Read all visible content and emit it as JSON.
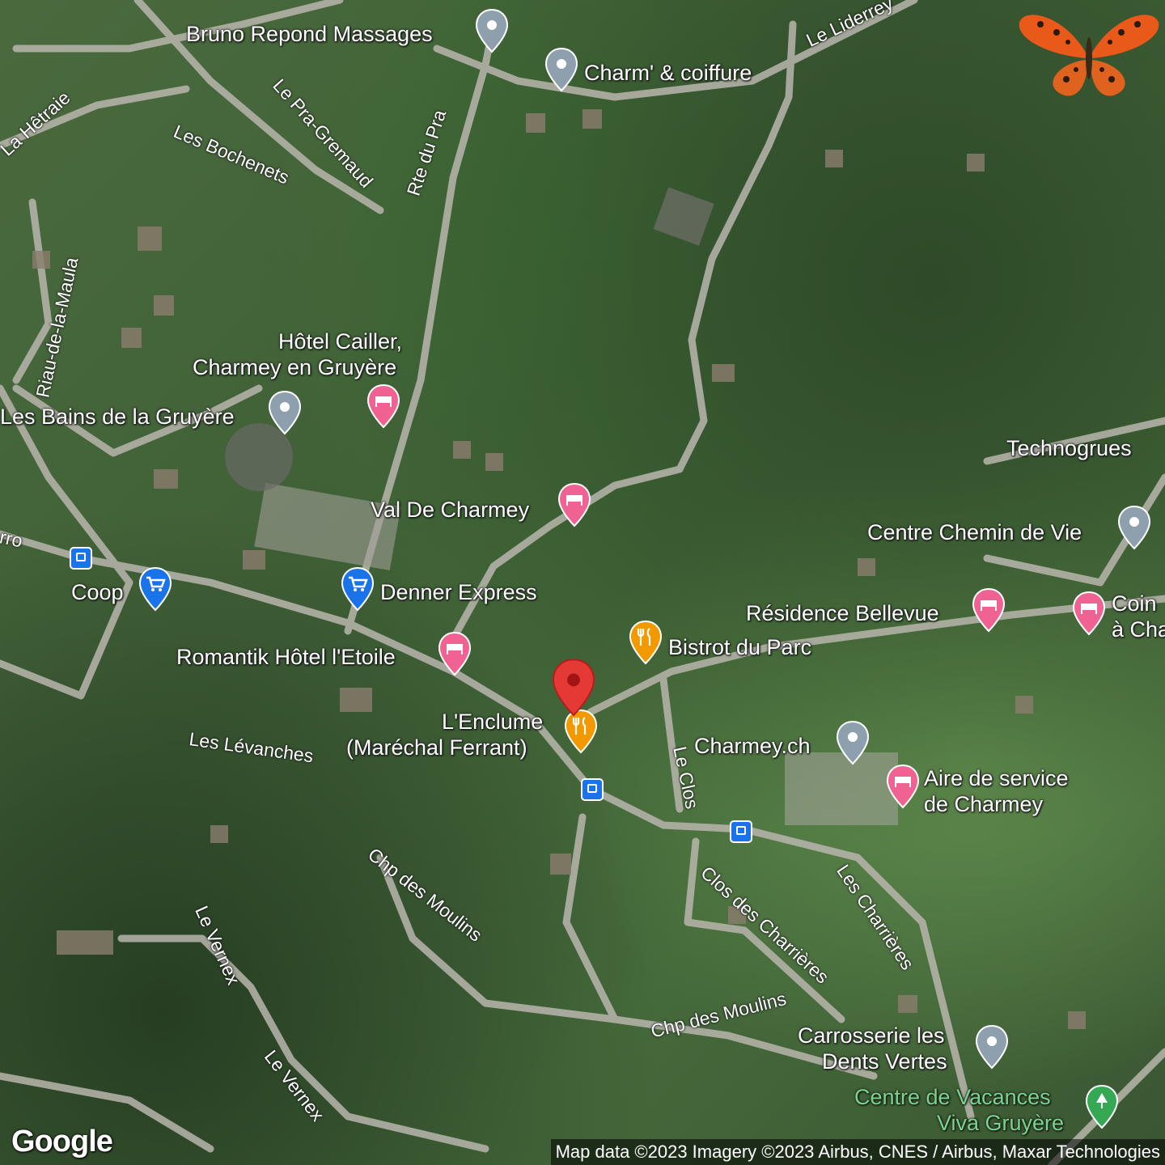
{
  "map": {
    "type": "satellite",
    "selected_marker": "L'Enclume (Maréchal Ferrant)",
    "colors": {
      "selected_pin": "#e53935",
      "lodging_pin": "#f06292",
      "restaurant_pin": "#f29900",
      "shopping_pin": "#1a73e8",
      "generic_pin": "#8ea0ad",
      "park_pin": "#34a853",
      "transit": "#1a73e8"
    }
  },
  "places": {
    "bruno": "Bruno Repond Massages",
    "charm": "Charm' & coiffure",
    "hotel_cailler_1": "Hôtel Cailler,",
    "hotel_cailler_2": "Charmey en Gruyère",
    "bains": "Les Bains de la Gruyère",
    "val_de_charmey": "Val De Charmey",
    "coop": "Coop",
    "denner": "Denner Express",
    "romantik": "Romantik Hôtel l'Etoile",
    "bistrot": "Bistrot du Parc",
    "residence": "Résidence Bellevue",
    "coin_1": "Coin",
    "coin_2": "à Cha",
    "technogrues": "Technogrues",
    "centre_chemin": "Centre Chemin de Vie",
    "enclume_1": "L'Enclume",
    "enclume_2": "(Maréchal Ferrant)",
    "charmey_ch": "Charmey.ch",
    "aire_1": "Aire de service",
    "aire_2": "de Charmey",
    "carrosserie_1": "Carrosserie les",
    "carrosserie_2": "Dents Vertes",
    "vacances_1": "Centre de Vacances",
    "vacances_2": "Viva Gruyère"
  },
  "roads": {
    "liderrey": "Le Liderrey",
    "hetraie": "La Hêtraie",
    "bochenets": "Les Bochenets",
    "pra_gremaud": "Le Pra-Gremaud",
    "rte_pra": "Rte du Pra",
    "riau": "Riau-de-la-Maula",
    "ro": "rro",
    "levanches": "Les Lévanches",
    "le_clos": "Le Clos",
    "chp_moulins_1": "Chp des Moulins",
    "chp_moulins_2": "Chp des Moulins",
    "clos_charrieres": "Clos des Charrières",
    "charrieres": "Les Charrières",
    "vernex_1": "Le Vernex",
    "vernex_2": "Le Vernex"
  },
  "footer": {
    "logo": "Google",
    "attribution": "Map data ©2023 Imagery ©2023 Airbus, CNES / Airbus, Maxar Technologies"
  }
}
